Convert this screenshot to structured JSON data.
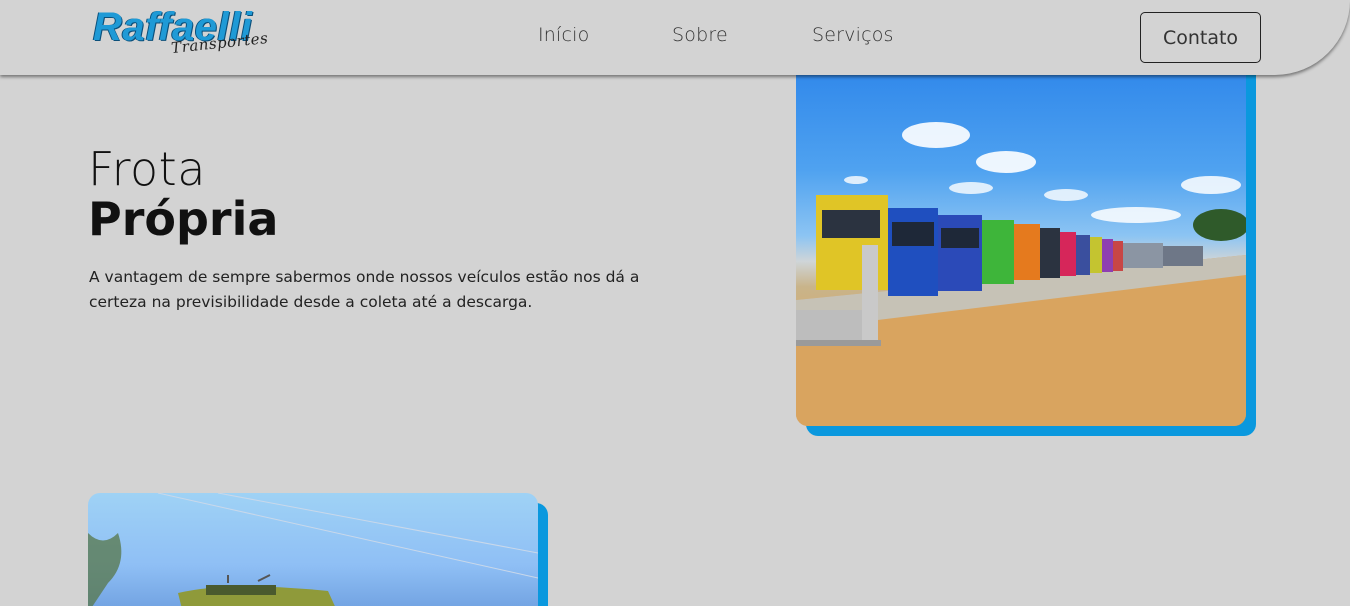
{
  "header": {
    "logo_main": "Raffaelli",
    "logo_sub": "Transportes",
    "nav": [
      "Início",
      "Sobre",
      "Serviços"
    ],
    "contact_label": "Contato"
  },
  "hero": {
    "title_light": "Frota",
    "title_bold": "Própria",
    "description": "A vantagem de sempre sabermos onde nossos veículos estão nos dá a certeza na previsibilidade desde a coleta até a descarga."
  },
  "colors": {
    "background": "#d3d3d3",
    "accent": "#0a98de",
    "logo_blue": "#1f9ad6"
  },
  "images": [
    {
      "name": "fleet-trucks-photo"
    },
    {
      "name": "truck-photo"
    }
  ]
}
